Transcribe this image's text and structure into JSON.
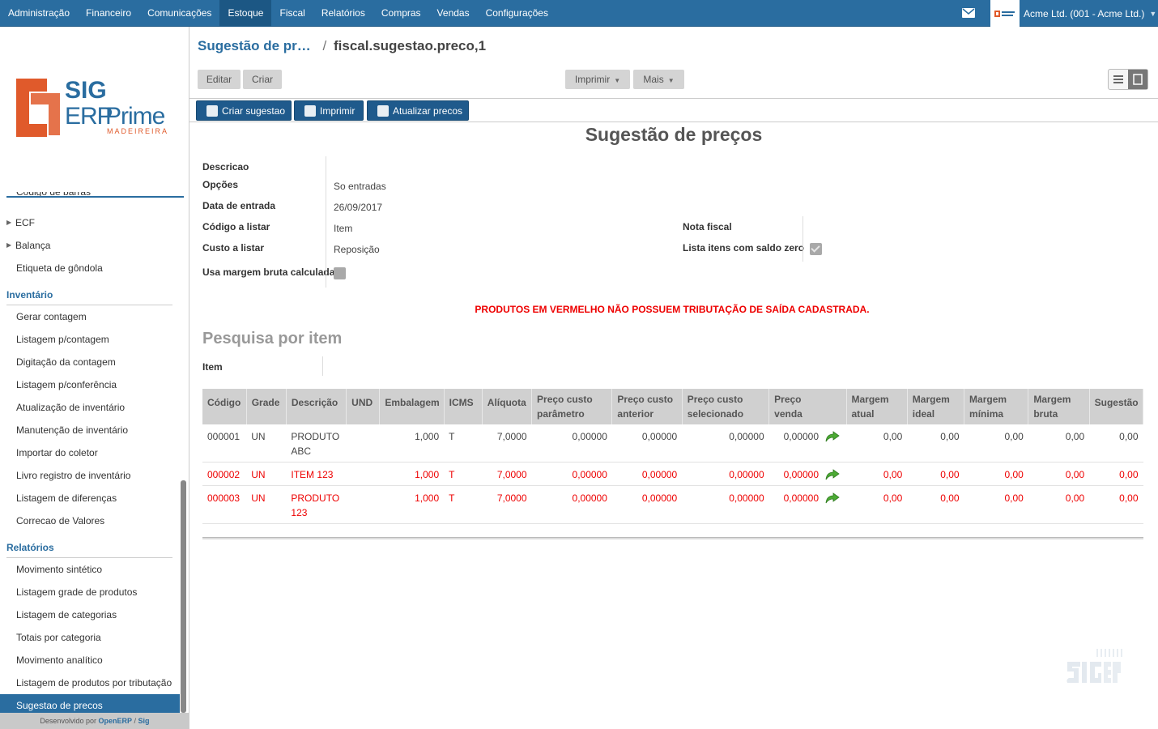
{
  "topbar": {
    "menu": [
      "Administração",
      "Financeiro",
      "Comunicações",
      "Estoque",
      "Fiscal",
      "Relatórios",
      "Compras",
      "Vendas",
      "Configurações"
    ],
    "active": "Estoque",
    "company": "Acme Ltd. (001 - Acme Ltd.)"
  },
  "sidebar": {
    "logo": {
      "line1": "SIG",
      "line2": "ERP",
      "line3": "Prime",
      "tagline": "MADEIREIRA"
    },
    "items_top": [
      {
        "label": "Código de barras"
      },
      {
        "label": "ECF",
        "expandable": true
      },
      {
        "label": "Balança",
        "expandable": true
      },
      {
        "label": "Etiqueta de gôndola"
      }
    ],
    "sections": [
      {
        "title": "Inventário",
        "items": [
          "Gerar contagem",
          "Listagem p/contagem",
          "Digitação da contagem",
          "Listagem p/conferência",
          "Atualização de inventário",
          "Manutenção de inventário",
          "Importar do coletor",
          "Livro registro de inventário",
          "Listagem de diferenças",
          "Correcao de Valores"
        ]
      },
      {
        "title": "Relatórios",
        "items": [
          "Movimento sintético",
          "Listagem grade de produtos",
          "Listagem de categorias",
          "Totais por categoria",
          "Movimento analítico",
          "Listagem de produtos por tributação",
          "Sugestao de precos"
        ]
      }
    ],
    "selected": "Sugestao de precos",
    "footer": {
      "prefix": "Desenvolvido por",
      "link1": "OpenERP",
      "slash": "/",
      "link2": "Sig"
    }
  },
  "breadcrumb": {
    "parent": "Sugestão de pr…",
    "separator": "/",
    "current": "fiscal.sugestao.preco,1"
  },
  "toolbar": {
    "edit": "Editar",
    "create": "Criar",
    "print": "Imprimir",
    "more": "Mais",
    "actions": [
      "Criar sugestao",
      "Imprimir",
      "Atualizar precos"
    ]
  },
  "form": {
    "title": "Sugestão de preços",
    "fields": {
      "descricao": {
        "label": "Descricao",
        "value": ""
      },
      "opcoes": {
        "label": "Opções",
        "value": "So entradas"
      },
      "data_entrada": {
        "label": "Data de entrada",
        "value": "26/09/2017"
      },
      "codigo_listar": {
        "label": "Código a listar",
        "value": "Item"
      },
      "custo_listar": {
        "label": "Custo a listar",
        "value": "Reposição"
      },
      "usa_margem": {
        "label": "Usa margem bruta calculada",
        "checked": false
      },
      "nota_fiscal": {
        "label": "Nota fiscal",
        "value": ""
      },
      "lista_saldo_zero": {
        "label": "Lista itens com saldo zero",
        "checked": true
      }
    },
    "warning": "PRODUTOS EM VERMELHO NÃO POSSUEM TRIBUTAÇÃO DE SAÍDA CADASTRADA.",
    "search_title": "Pesquisa por item",
    "item_label": "Item"
  },
  "table": {
    "headers": [
      [
        "Código"
      ],
      [
        "Grade"
      ],
      [
        "Descrição"
      ],
      [
        "UND"
      ],
      [
        "Embalagem"
      ],
      [
        "ICMS"
      ],
      [
        "Alíquota"
      ],
      [
        "Preço custo",
        "parâmetro"
      ],
      [
        "Preço custo",
        "anterior"
      ],
      [
        "Preço custo",
        "selecionado"
      ],
      [
        "Preço",
        "venda"
      ],
      [
        "Margem",
        "atual"
      ],
      [
        "Margem",
        "ideal"
      ],
      [
        "Margem",
        "mínima"
      ],
      [
        "Margem",
        "bruta"
      ],
      [
        "Sugestão"
      ]
    ],
    "rows": [
      {
        "red": false,
        "cells": [
          "000001",
          "UN",
          "PRODUTO ABC",
          "",
          "1,000",
          "T",
          "7,0000",
          "0,00000",
          "0,00000",
          "0,00000",
          "0,00000",
          "0,00",
          "0,00",
          "0,00",
          "0,00",
          "0,00"
        ]
      },
      {
        "red": true,
        "cells": [
          "000002",
          "UN",
          "ITEM 123",
          "",
          "1,000",
          "T",
          "7,0000",
          "0,00000",
          "0,00000",
          "0,00000",
          "0,00000",
          "0,00",
          "0,00",
          "0,00",
          "0,00",
          "0,00"
        ]
      },
      {
        "red": true,
        "cells": [
          "000003",
          "UN",
          "PRODUTO 123",
          "",
          "1,000",
          "T",
          "7,0000",
          "0,00000",
          "0,00000",
          "0,00000",
          "0,00000",
          "0,00",
          "0,00",
          "0,00",
          "0,00",
          "0,00"
        ]
      }
    ]
  },
  "colors": {
    "brand": "#2a6da0",
    "alert": "#e00000",
    "accent_orange": "#e05a2b"
  }
}
